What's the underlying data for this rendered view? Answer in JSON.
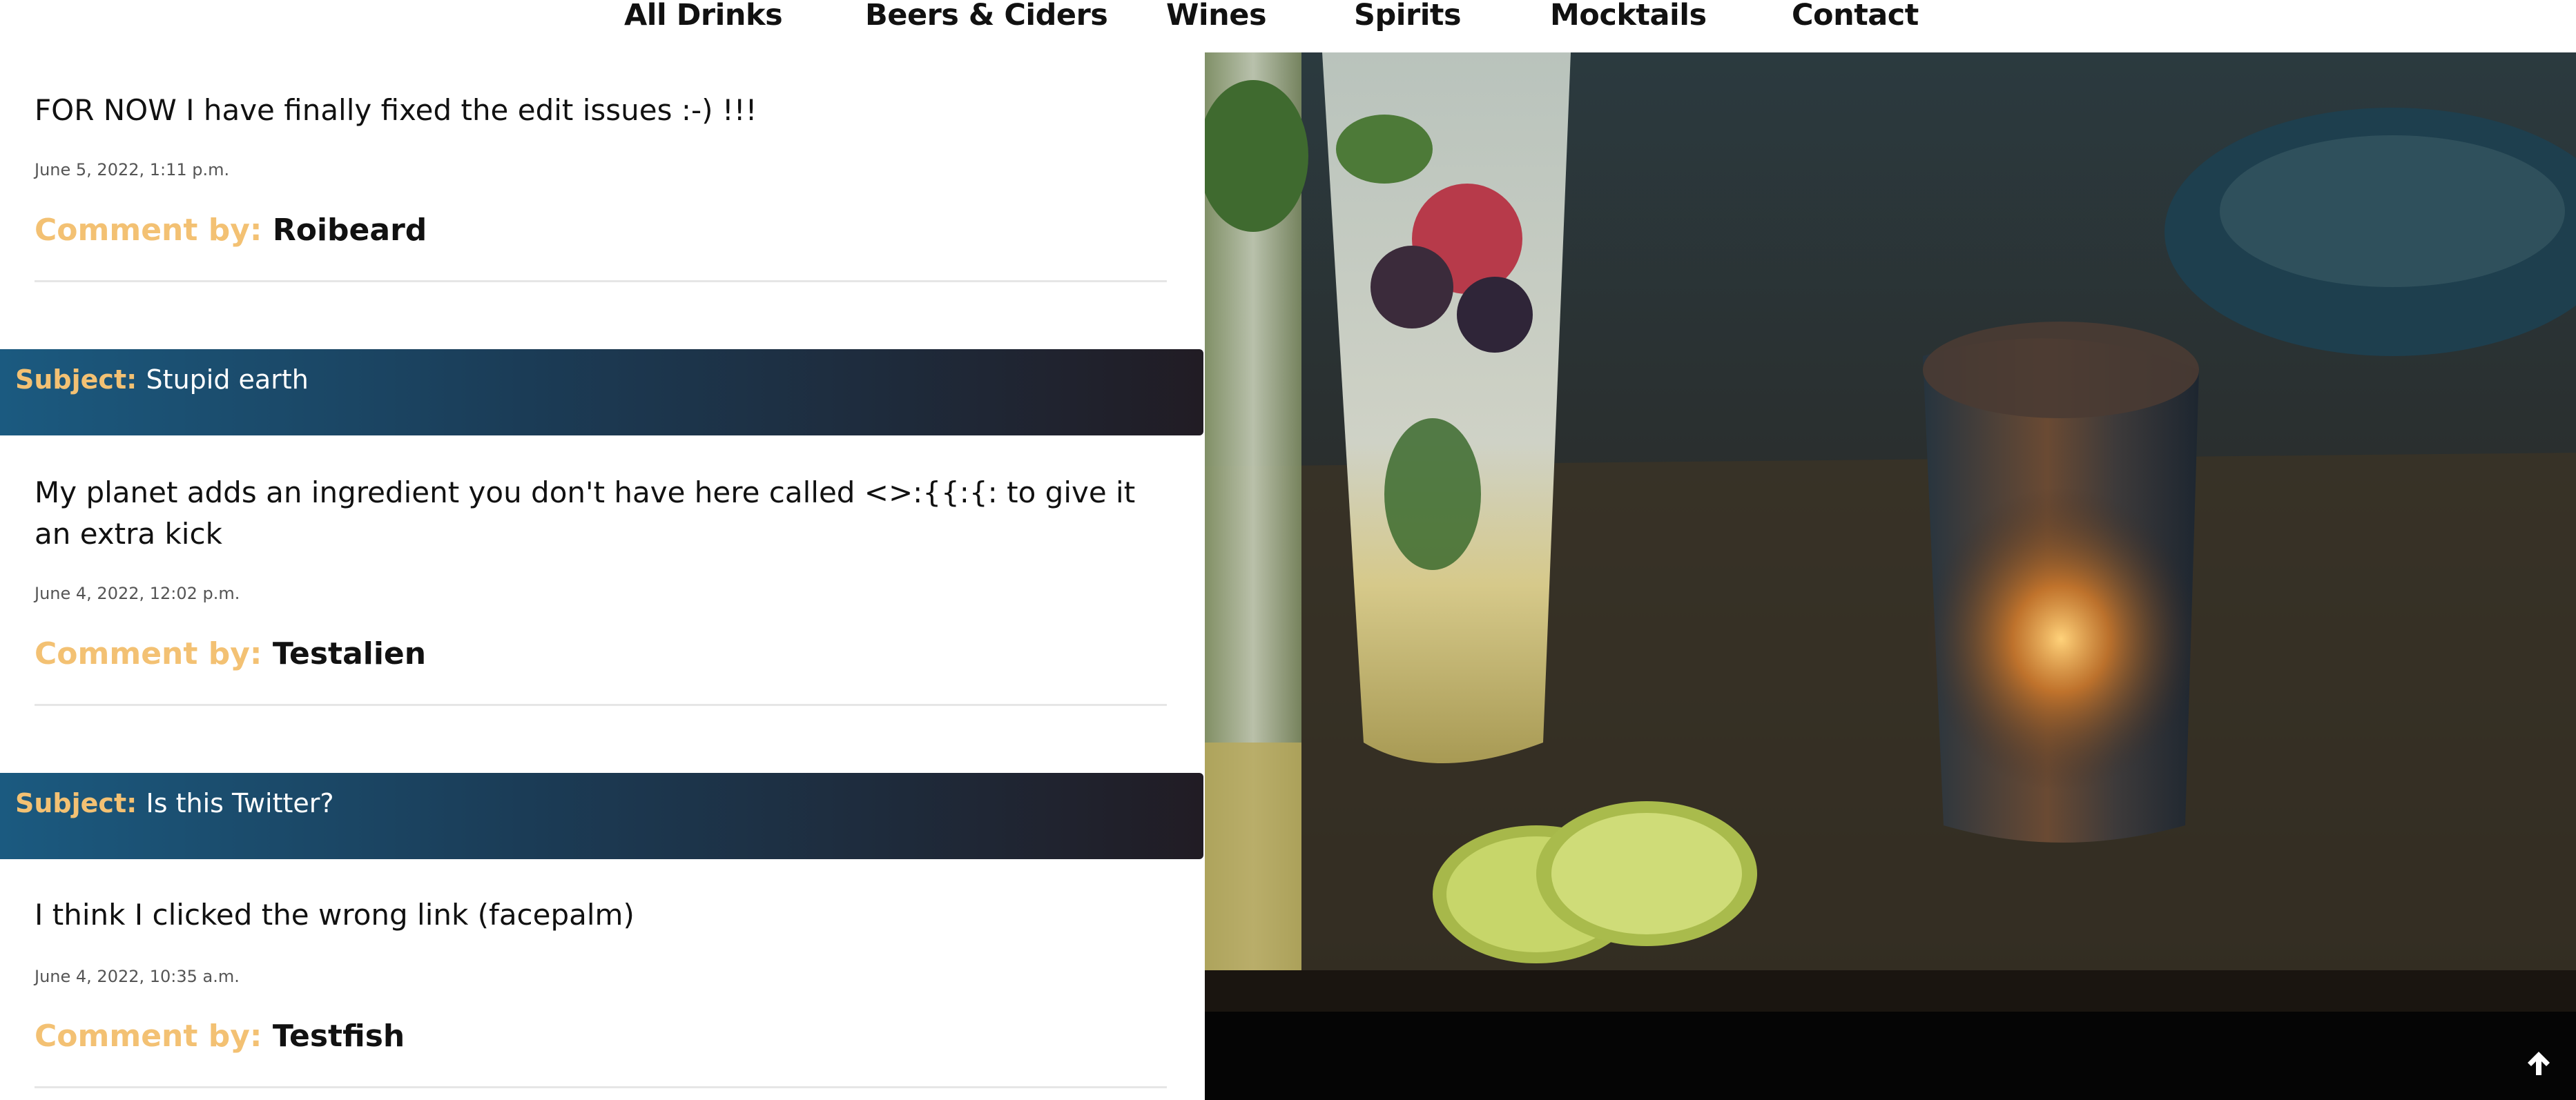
{
  "nav": {
    "items": [
      {
        "label": "All Drinks"
      },
      {
        "label": "Beers & Ciders"
      },
      {
        "label": "Wines"
      },
      {
        "label": "Spirits"
      },
      {
        "label": "Mocktails"
      },
      {
        "label": "Contact"
      }
    ]
  },
  "comments": [
    {
      "subject_label": "",
      "subject": "",
      "body": "FOR NOW I have finally fixed the edit issues :-) !!!",
      "date": "June 5, 2022, 1:11 p.m.",
      "by_label": "Comment by:",
      "author": "Roibeard"
    },
    {
      "subject_label": "Subject:",
      "subject": "Stupid earth",
      "body": "My planet adds an ingredient you don't have here called <>:{{:{: to give it an extra kick",
      "date": "June 4, 2022, 12:02 p.m.",
      "by_label": "Comment by:",
      "author": "Testalien"
    },
    {
      "subject_label": "Subject:",
      "subject": "Is this Twitter?",
      "body": "I think I clicked the wrong link (facepalm)",
      "date": "June 4, 2022, 10:35 a.m.",
      "by_label": "Comment by:",
      "author": "Testfish"
    }
  ],
  "hero": {
    "image_description_icon": "drinks-photo"
  },
  "back_to_top": {
    "icon": "arrow-up-icon"
  },
  "colors": {
    "accent": "#f3c173",
    "subject_bar_start": "#1b5a80",
    "subject_bar_end": "#211c24"
  }
}
